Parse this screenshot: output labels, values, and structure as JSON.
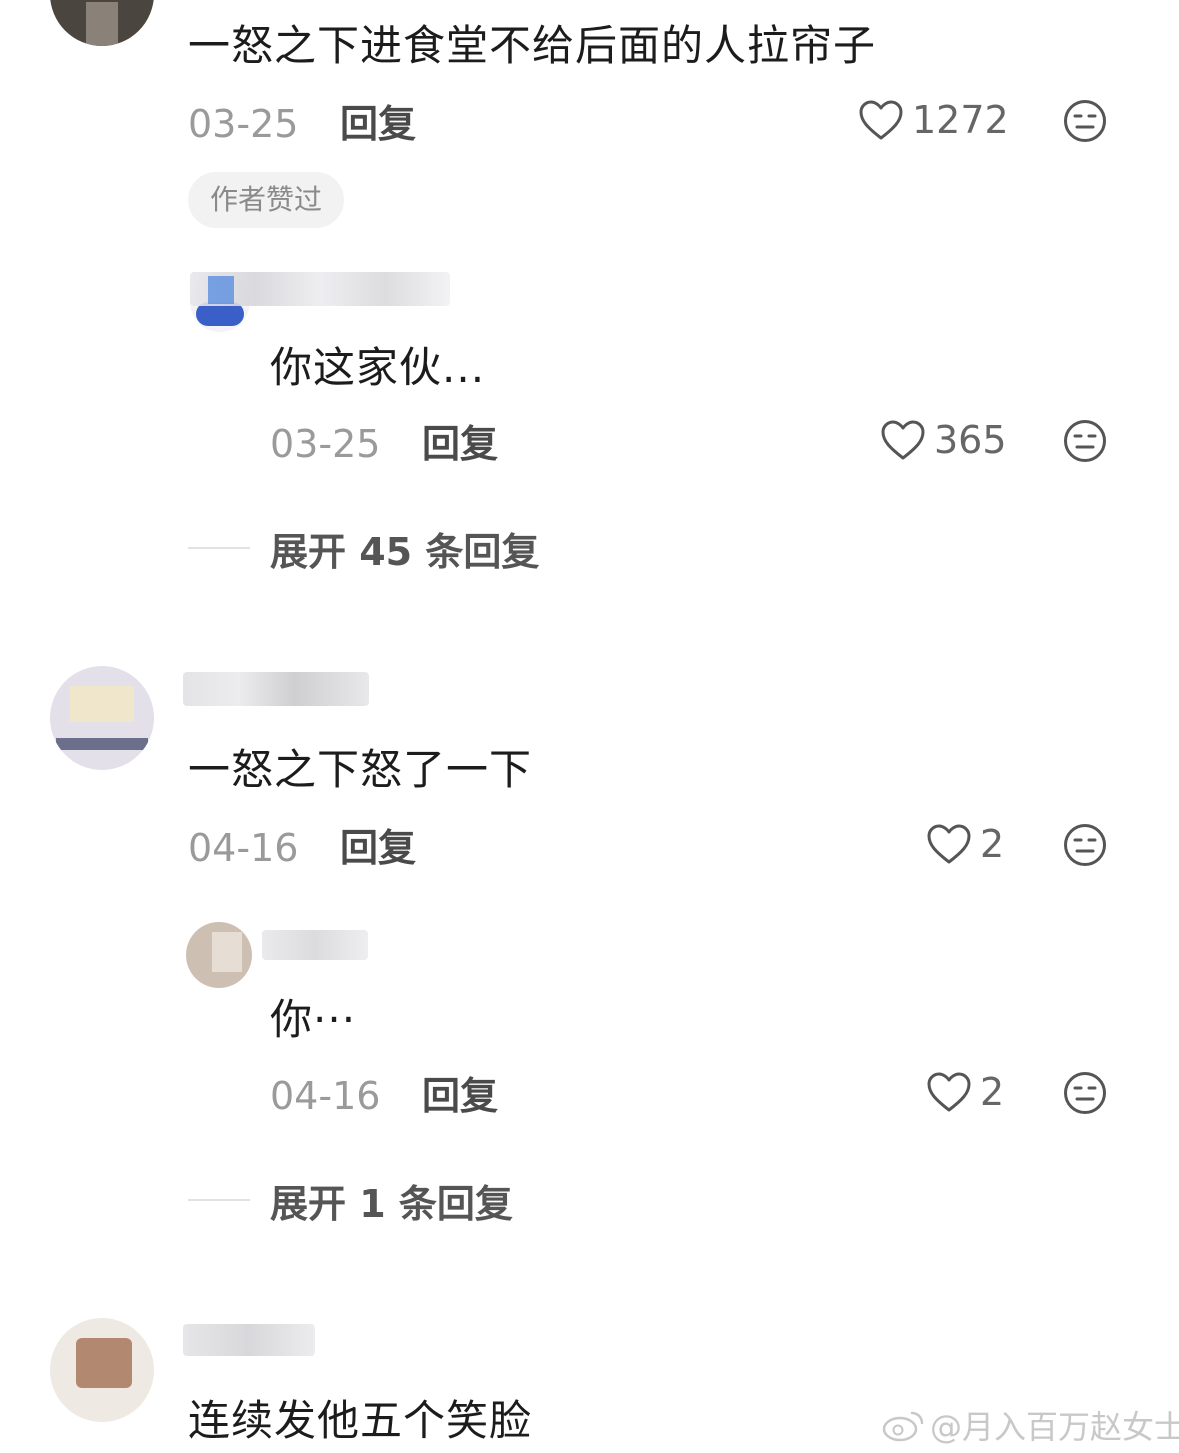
{
  "comments": [
    {
      "text": "一怒之下进食堂不给后面的人拉帘子",
      "date": "03-25",
      "reply_label": "回复",
      "likes": "1272",
      "badge": "作者赞过",
      "sub_reply": {
        "text": "你这家伙...",
        "date": "03-25",
        "reply_label": "回复",
        "likes": "365"
      },
      "expand_label": "展开 45 条回复"
    },
    {
      "text": "一怒之下怒了一下",
      "date": "04-16",
      "reply_label": "回复",
      "likes": "2",
      "sub_reply": {
        "text": "你···",
        "date": "04-16",
        "reply_label": "回复",
        "likes": "2"
      },
      "expand_label": "展开 1 条回复"
    },
    {
      "text": "连续发他五个笑脸"
    }
  ],
  "watermark": "@月入百万赵女士",
  "icons": {
    "like": "heart-outline-icon",
    "emoji": "neutral-face-icon",
    "watermark": "weibo-logo-icon"
  },
  "colors": {
    "text": "#1c1c1c",
    "meta": "#9a9a9a",
    "badge_bg": "#f2f2f2"
  }
}
